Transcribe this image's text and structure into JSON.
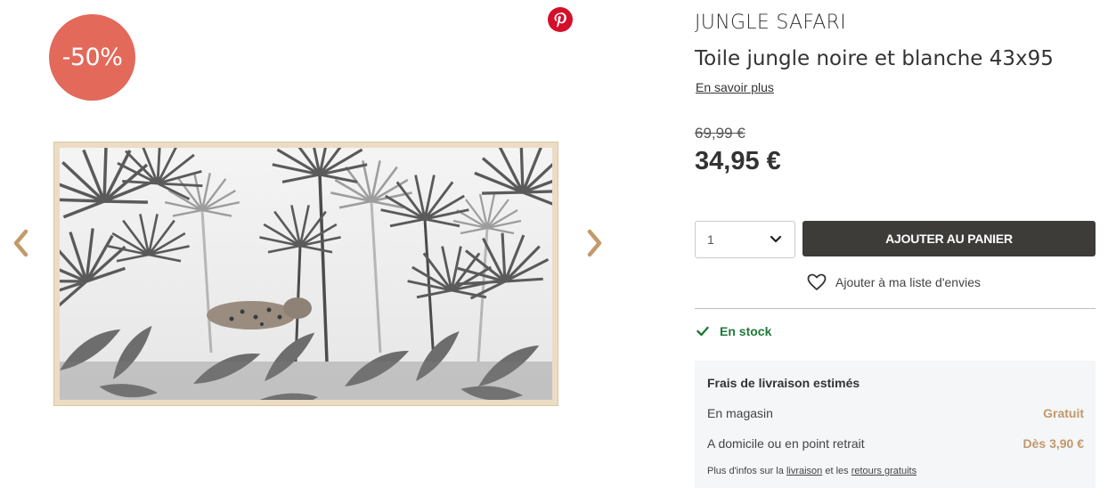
{
  "gallery": {
    "discount_badge": "-50%",
    "pinterest_icon": "pinterest-icon",
    "prev_icon": "chevron-left-icon",
    "next_icon": "chevron-right-icon",
    "image_alt": "Toile jungle noire et blanche 43x95"
  },
  "product": {
    "brand": "JUNGLE SAFARI",
    "name": "Toile jungle noire et blanche 43x95",
    "learn_more": "En savoir plus",
    "old_price": "69,99 €",
    "price": "34,95 €"
  },
  "cart": {
    "quantity": "1",
    "add_to_cart": "AJOUTER AU PANIER",
    "wishlist": "Ajouter à ma liste d'envies"
  },
  "stock": {
    "label": "En stock"
  },
  "shipping": {
    "title": "Frais de livraison estimés",
    "rows": [
      {
        "label": "En magasin",
        "value": "Gratuit"
      },
      {
        "label": "A domicile ou en point retrait",
        "value": "Dès 3,90 €"
      }
    ],
    "note_prefix": "Plus d'infos sur la",
    "note_link1": "livraison",
    "note_middle": "et les",
    "note_link2": "retours gratuits"
  },
  "colors": {
    "badge": "#e3695a",
    "button": "#3d3c39",
    "stock": "#1e7a3a",
    "accent": "#c0996a",
    "arrow": "#c49a6c",
    "pinterest": "#d40f2a"
  }
}
